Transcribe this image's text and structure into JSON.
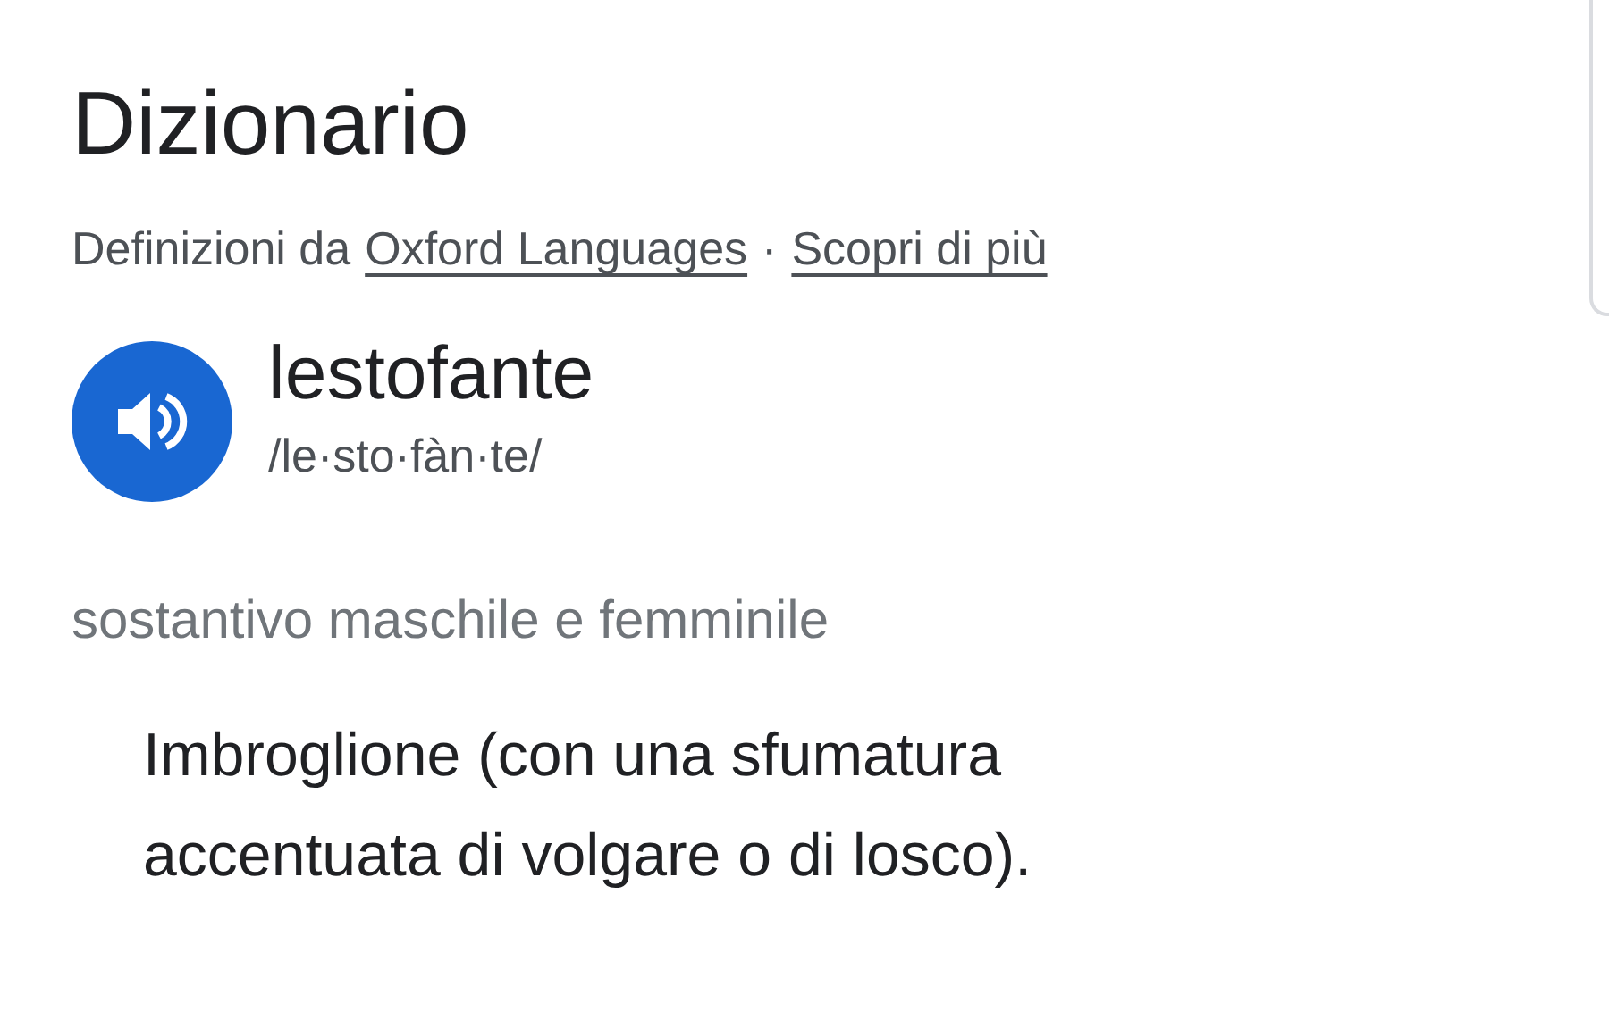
{
  "title": "Dizionario",
  "source": {
    "prefix": "Definizioni da",
    "links": [
      "Oxford Languages",
      "Scopri di più"
    ],
    "separator": "·"
  },
  "entry": {
    "word": "lestofante",
    "pronunciation": "/le·sto·fàn·te/",
    "part_of_speech": "sostantivo maschile e femminile",
    "definition": "Imbroglione (con una sfumatura accentuata di volgare o di losco)."
  }
}
